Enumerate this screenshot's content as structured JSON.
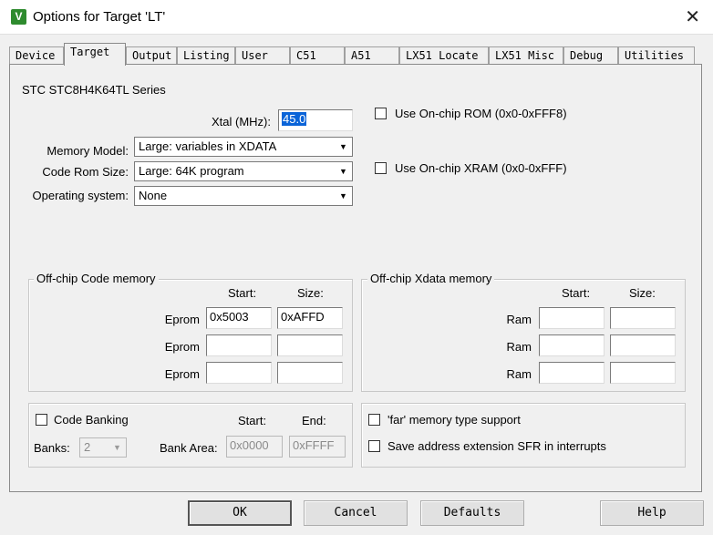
{
  "window": {
    "title": "Options for Target 'LT'",
    "app_icon_glyph": "V"
  },
  "tabs": [
    {
      "label": "Device"
    },
    {
      "label": "Target"
    },
    {
      "label": "Output"
    },
    {
      "label": "Listing"
    },
    {
      "label": "User"
    },
    {
      "label": "C51"
    },
    {
      "label": "A51"
    },
    {
      "label": "LX51 Locate"
    },
    {
      "label": "LX51 Misc"
    },
    {
      "label": "Debug"
    },
    {
      "label": "Utilities"
    }
  ],
  "target": {
    "device_name": "STC STC8H4K64TL Series",
    "xtal": {
      "label": "Xtal (MHz):",
      "value": "45.0"
    },
    "memory_model": {
      "label": "Memory Model:",
      "value": "Large: variables in XDATA"
    },
    "code_rom_size": {
      "label": "Code Rom Size:",
      "value": "Large: 64K program"
    },
    "operating_system": {
      "label": "Operating system:",
      "value": "None"
    },
    "use_onchip_rom": {
      "label": "Use On-chip ROM (0x0-0xFFF8)",
      "checked": false
    },
    "use_onchip_xram": {
      "label": "Use On-chip XRAM (0x0-0xFFF)",
      "checked": false
    }
  },
  "code_memory": {
    "title": "Off-chip Code memory",
    "start_header": "Start:",
    "size_header": "Size:",
    "rows": [
      {
        "label": "Eprom",
        "start": "0x5003",
        "size": "0xAFFD"
      },
      {
        "label": "Eprom",
        "start": "",
        "size": ""
      },
      {
        "label": "Eprom",
        "start": "",
        "size": ""
      }
    ]
  },
  "xdata_memory": {
    "title": "Off-chip Xdata memory",
    "start_header": "Start:",
    "size_header": "Size:",
    "rows": [
      {
        "label": "Ram",
        "start": "",
        "size": ""
      },
      {
        "label": "Ram",
        "start": "",
        "size": ""
      },
      {
        "label": "Ram",
        "start": "",
        "size": ""
      }
    ]
  },
  "banking": {
    "code_banking_label": "Code Banking",
    "code_banking_checked": false,
    "banks_label": "Banks:",
    "banks_value": "2",
    "start_header": "Start:",
    "end_header": "End:",
    "bank_area_label": "Bank Area:",
    "bank_area_start": "0x0000",
    "bank_area_end": "0xFFFF"
  },
  "options": {
    "far_memory_label": "'far' memory type support",
    "far_memory_checked": false,
    "save_sfr_label": "Save address extension SFR in interrupts",
    "save_sfr_checked": false
  },
  "buttons": {
    "ok": "OK",
    "cancel": "Cancel",
    "defaults": "Defaults",
    "help": "Help"
  }
}
